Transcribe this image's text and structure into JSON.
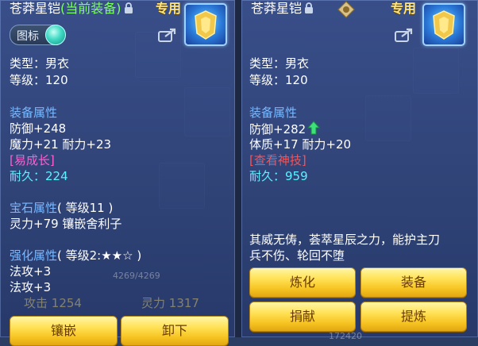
{
  "left": {
    "title": "苍莽星铠",
    "title_sub": "(当前装备)",
    "exclusive": "专用",
    "tag_label": "图标",
    "type": "类型：男衣",
    "level": "等级：120",
    "attr_header": "装备属性",
    "defense": "防御+248",
    "magic_stamina": "魔力+21 耐力+23",
    "growth": "[易成长]",
    "durability_label": "耐久：",
    "durability_value": "224",
    "gem_header": "宝石属性",
    "gem_level": "( 等级11 )",
    "gem_effect": "灵力+79 镶嵌舍利子",
    "enhance_header": "强化属性",
    "enhance_level": "( 等级2:★★☆ )",
    "enhance_1": "法攻+3",
    "enhance_2": "法攻+3",
    "buttons": {
      "inlay": "镶嵌",
      "unequip": "卸下"
    }
  },
  "right": {
    "title": "苍莽星铠",
    "exclusive": "专用",
    "type": "类型：男衣",
    "level": "等级：120",
    "attr_header": "装备属性",
    "defense": "防御+282",
    "physique_stamina": "体质+17 耐力+20",
    "divine_skill": "[查看神技]",
    "durability_label": "耐久：",
    "durability_value": "959",
    "description_1": "其威无俦，荟萃星辰之力，能护主刀",
    "description_2": "兵不伤、轮回不堕",
    "buttons": {
      "refine": "炼化",
      "equip": "装备",
      "donate": "捐献",
      "extract": "提炼"
    }
  },
  "background": {
    "attack_label": "攻击",
    "attack_value": "1254",
    "spirit_label": "灵力",
    "spirit_value": "1317",
    "hp_text": "4269/4269",
    "bottom_value": "172420"
  },
  "colors": {
    "attr_header": "#7ab8ff",
    "durability": "#5ff0ff",
    "growth": "#ff5fd2",
    "divine_skill": "#ff5050",
    "button_gold": "#f7c624",
    "title_sub": "#7dff62"
  }
}
